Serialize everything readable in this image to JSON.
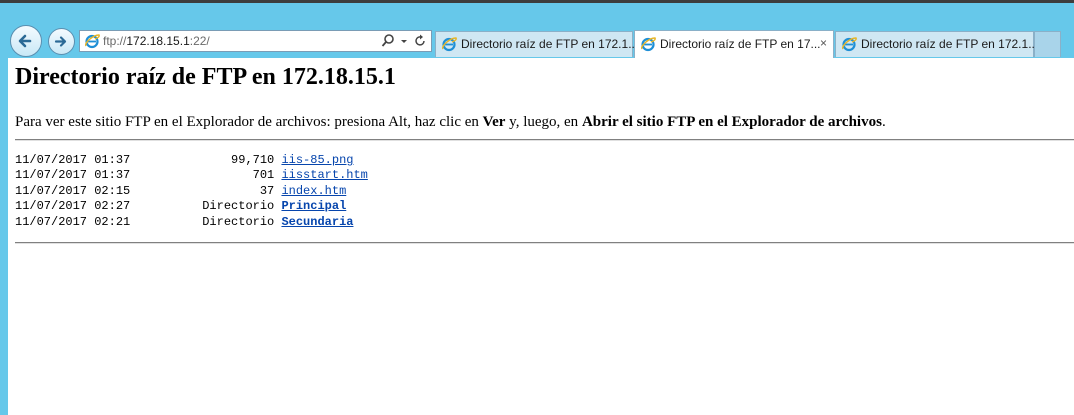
{
  "browser": {
    "address": {
      "scheme": "ftp://",
      "host": "172.18.15.1",
      "rest": ":22/"
    },
    "tabs": [
      {
        "label": "Directorio raíz de FTP en 172.1...",
        "active": false
      },
      {
        "label": "Directorio raíz de FTP en 17...",
        "active": true,
        "close": "×"
      },
      {
        "label": "Directorio raíz de FTP en 172.1...",
        "active": false
      }
    ]
  },
  "page": {
    "title": "Directorio raíz de FTP en 172.18.15.1",
    "intro": {
      "part1": "Para ver este sitio FTP en el Explorador de archivos: presiona Alt, haz clic en ",
      "bold1": "Ver",
      "part2": " y, luego, en ",
      "bold2": "Abrir el sitio FTP en el Explorador de archivos",
      "part3": "."
    },
    "listing": [
      {
        "date": "11/07/2017",
        "time": "01:37",
        "size": "99,710",
        "name": "iis-85.png",
        "is_dir": false
      },
      {
        "date": "11/07/2017",
        "time": "01:37",
        "size": "701",
        "name": "iisstart.htm",
        "is_dir": false
      },
      {
        "date": "11/07/2017",
        "time": "02:15",
        "size": "37",
        "name": "index.htm",
        "is_dir": false
      },
      {
        "date": "11/07/2017",
        "time": "02:27",
        "size": "Directorio",
        "name": "Principal",
        "is_dir": true
      },
      {
        "date": "11/07/2017",
        "time": "02:21",
        "size": "Directorio",
        "name": "Secundaria",
        "is_dir": true
      }
    ]
  },
  "icons": {
    "back": "back-arrow-icon",
    "forward": "forward-arrow-icon",
    "favicon": "internet-explorer-icon",
    "search": "search-icon",
    "dropdown": "chevron-down-icon",
    "refresh": "refresh-icon"
  },
  "colors": {
    "chrome": "#66c8ea",
    "link": "#0645ad"
  }
}
